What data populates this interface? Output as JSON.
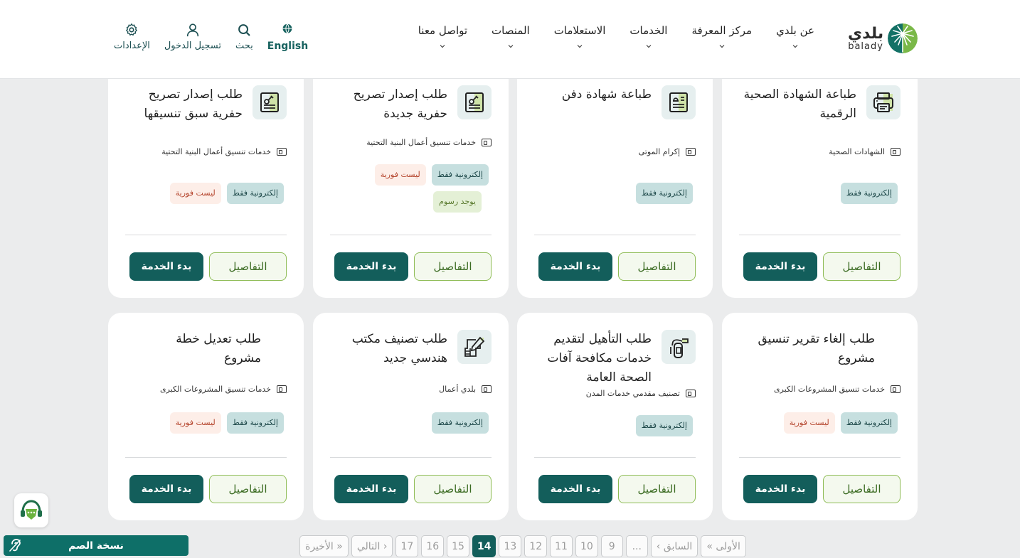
{
  "header": {
    "logo": {
      "ar": "بلدي",
      "en": "balady"
    },
    "nav": [
      {
        "label": "عن بلدي"
      },
      {
        "label": "مركز المعرفة"
      },
      {
        "label": "الخدمات"
      },
      {
        "label": "الاستعلامات"
      },
      {
        "label": "المنصات"
      },
      {
        "label": "تواصل معنا"
      }
    ],
    "utilities": {
      "language": "English",
      "search": "بحث",
      "login": "تسجيل الدخول",
      "settings": "الإعدادات"
    }
  },
  "cards": [
    {
      "title": "طباعة الشهادة الصحية الرقمية",
      "icon": "printer-icon",
      "category": "الشهادات الصحية",
      "badges": [
        {
          "type": "online",
          "label": "إلكترونية فقط"
        }
      ],
      "details_label": "التفاصيل",
      "start_label": "بدء الخدمة"
    },
    {
      "title": "طباعة شهادة دفن",
      "icon": "certificate-icon",
      "category": "إكرام الموتى",
      "badges": [
        {
          "type": "online",
          "label": "إلكترونية فقط"
        }
      ],
      "details_label": "التفاصيل",
      "start_label": "بدء الخدمة"
    },
    {
      "title": "طلب إصدار تصريح حفرية جديدة",
      "icon": "shovel-permit-icon",
      "category": "خدمات تنسيق أعمال البنية التحتية",
      "badges": [
        {
          "type": "online",
          "label": "إلكترونية فقط"
        },
        {
          "type": "notinstant",
          "label": "ليست فورية"
        },
        {
          "type": "fees",
          "label": "يوجد رسوم"
        }
      ],
      "details_label": "التفاصيل",
      "start_label": "بدء الخدمة"
    },
    {
      "title": "طلب إصدار تصريح حفرية سبق تنسيقها",
      "icon": "shovel-permit-icon",
      "category": "خدمات تنسيق أعمال البنية التحتية",
      "badges": [
        {
          "type": "online",
          "label": "إلكترونية فقط"
        },
        {
          "type": "notinstant",
          "label": "ليست فورية"
        }
      ],
      "details_label": "التفاصيل",
      "start_label": "بدء الخدمة"
    },
    {
      "title": "طلب إلغاء تقرير تنسيق مشروع",
      "icon": "",
      "category": "خدمات تنسيق المشروعات الكبرى",
      "badges": [
        {
          "type": "online",
          "label": "إلكترونية فقط"
        },
        {
          "type": "notinstant",
          "label": "ليست فورية"
        }
      ],
      "details_label": "التفاصيل",
      "start_label": "بدء الخدمة"
    },
    {
      "title": "طلب التأهيل لتقديم خدمات مكافحة آفات الصحة العامة",
      "icon": "pest-sprayer-icon",
      "category": "تصنيف مقدمي خدمات المدن",
      "badges": [
        {
          "type": "online",
          "label": "إلكترونية فقط"
        }
      ],
      "details_label": "التفاصيل",
      "start_label": "بدء الخدمة"
    },
    {
      "title": "طلب تصنيف مكتب هندسي جديد",
      "icon": "edit-document-icon",
      "category": "بلدي أعمال",
      "badges": [
        {
          "type": "online",
          "label": "إلكترونية فقط"
        }
      ],
      "details_label": "التفاصيل",
      "start_label": "بدء الخدمة"
    },
    {
      "title": "طلب تعديل خطة مشروع",
      "icon": "",
      "category": "خدمات تنسيق المشروعات الكبرى",
      "badges": [
        {
          "type": "online",
          "label": "إلكترونية فقط"
        },
        {
          "type": "notinstant",
          "label": "ليست فورية"
        }
      ],
      "details_label": "التفاصيل",
      "start_label": "بدء الخدمة"
    }
  ],
  "widgets": {
    "deaf_version": "نسخة الصم"
  },
  "pagination": {
    "first": "« الأولى",
    "prev": "‹ السابق",
    "ellipsis": "...",
    "pages": [
      "9",
      "10",
      "11",
      "12",
      "13",
      "14",
      "15",
      "16",
      "17"
    ],
    "current": "14",
    "next": "التالي ›",
    "last": "الأخيرة »"
  },
  "colors": {
    "primary": "#135e5b",
    "accent_green": "#8ebc55",
    "online_badge_bg": "#c6dfdf",
    "not_instant_badge_bg": "#fdeee8",
    "fees_badge_bg": "#e4f0d6"
  }
}
